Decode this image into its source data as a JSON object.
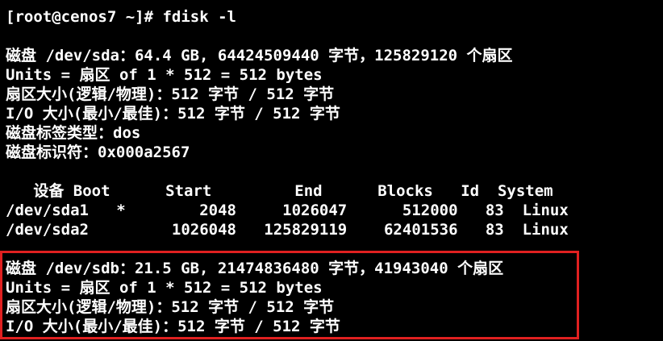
{
  "terminal": {
    "prompt": "[root@cenos7 ~]# ",
    "command": "fdisk -l",
    "lines": [
      "",
      "磁盘 /dev/sda：64.4 GB, 64424509440 字节，125829120 个扇区",
      "Units = 扇区 of 1 * 512 = 512 bytes",
      "扇区大小(逻辑/物理)：512 字节 / 512 字节",
      "I/O 大小(最小/最佳)：512 字节 / 512 字节",
      "磁盘标签类型：dos",
      "磁盘标识符：0x000a2567",
      "",
      "   设备 Boot      Start         End      Blocks   Id  System",
      "/dev/sda1   *        2048     1026047      512000   83  Linux",
      "/dev/sda2         1026048   125829119    62401536   83  Linux",
      "",
      "磁盘 /dev/sdb：21.5 GB, 21474836480 字节，41943040 个扇区",
      "Units = 扇区 of 1 * 512 = 512 bytes",
      "扇区大小(逻辑/物理)：512 字节 / 512 字节",
      "I/O 大小(最小/最佳)：512 字节 / 512 字节"
    ]
  },
  "colors": {
    "background": "#000000",
    "text": "#ffffff",
    "highlight_border": "#e02020"
  }
}
